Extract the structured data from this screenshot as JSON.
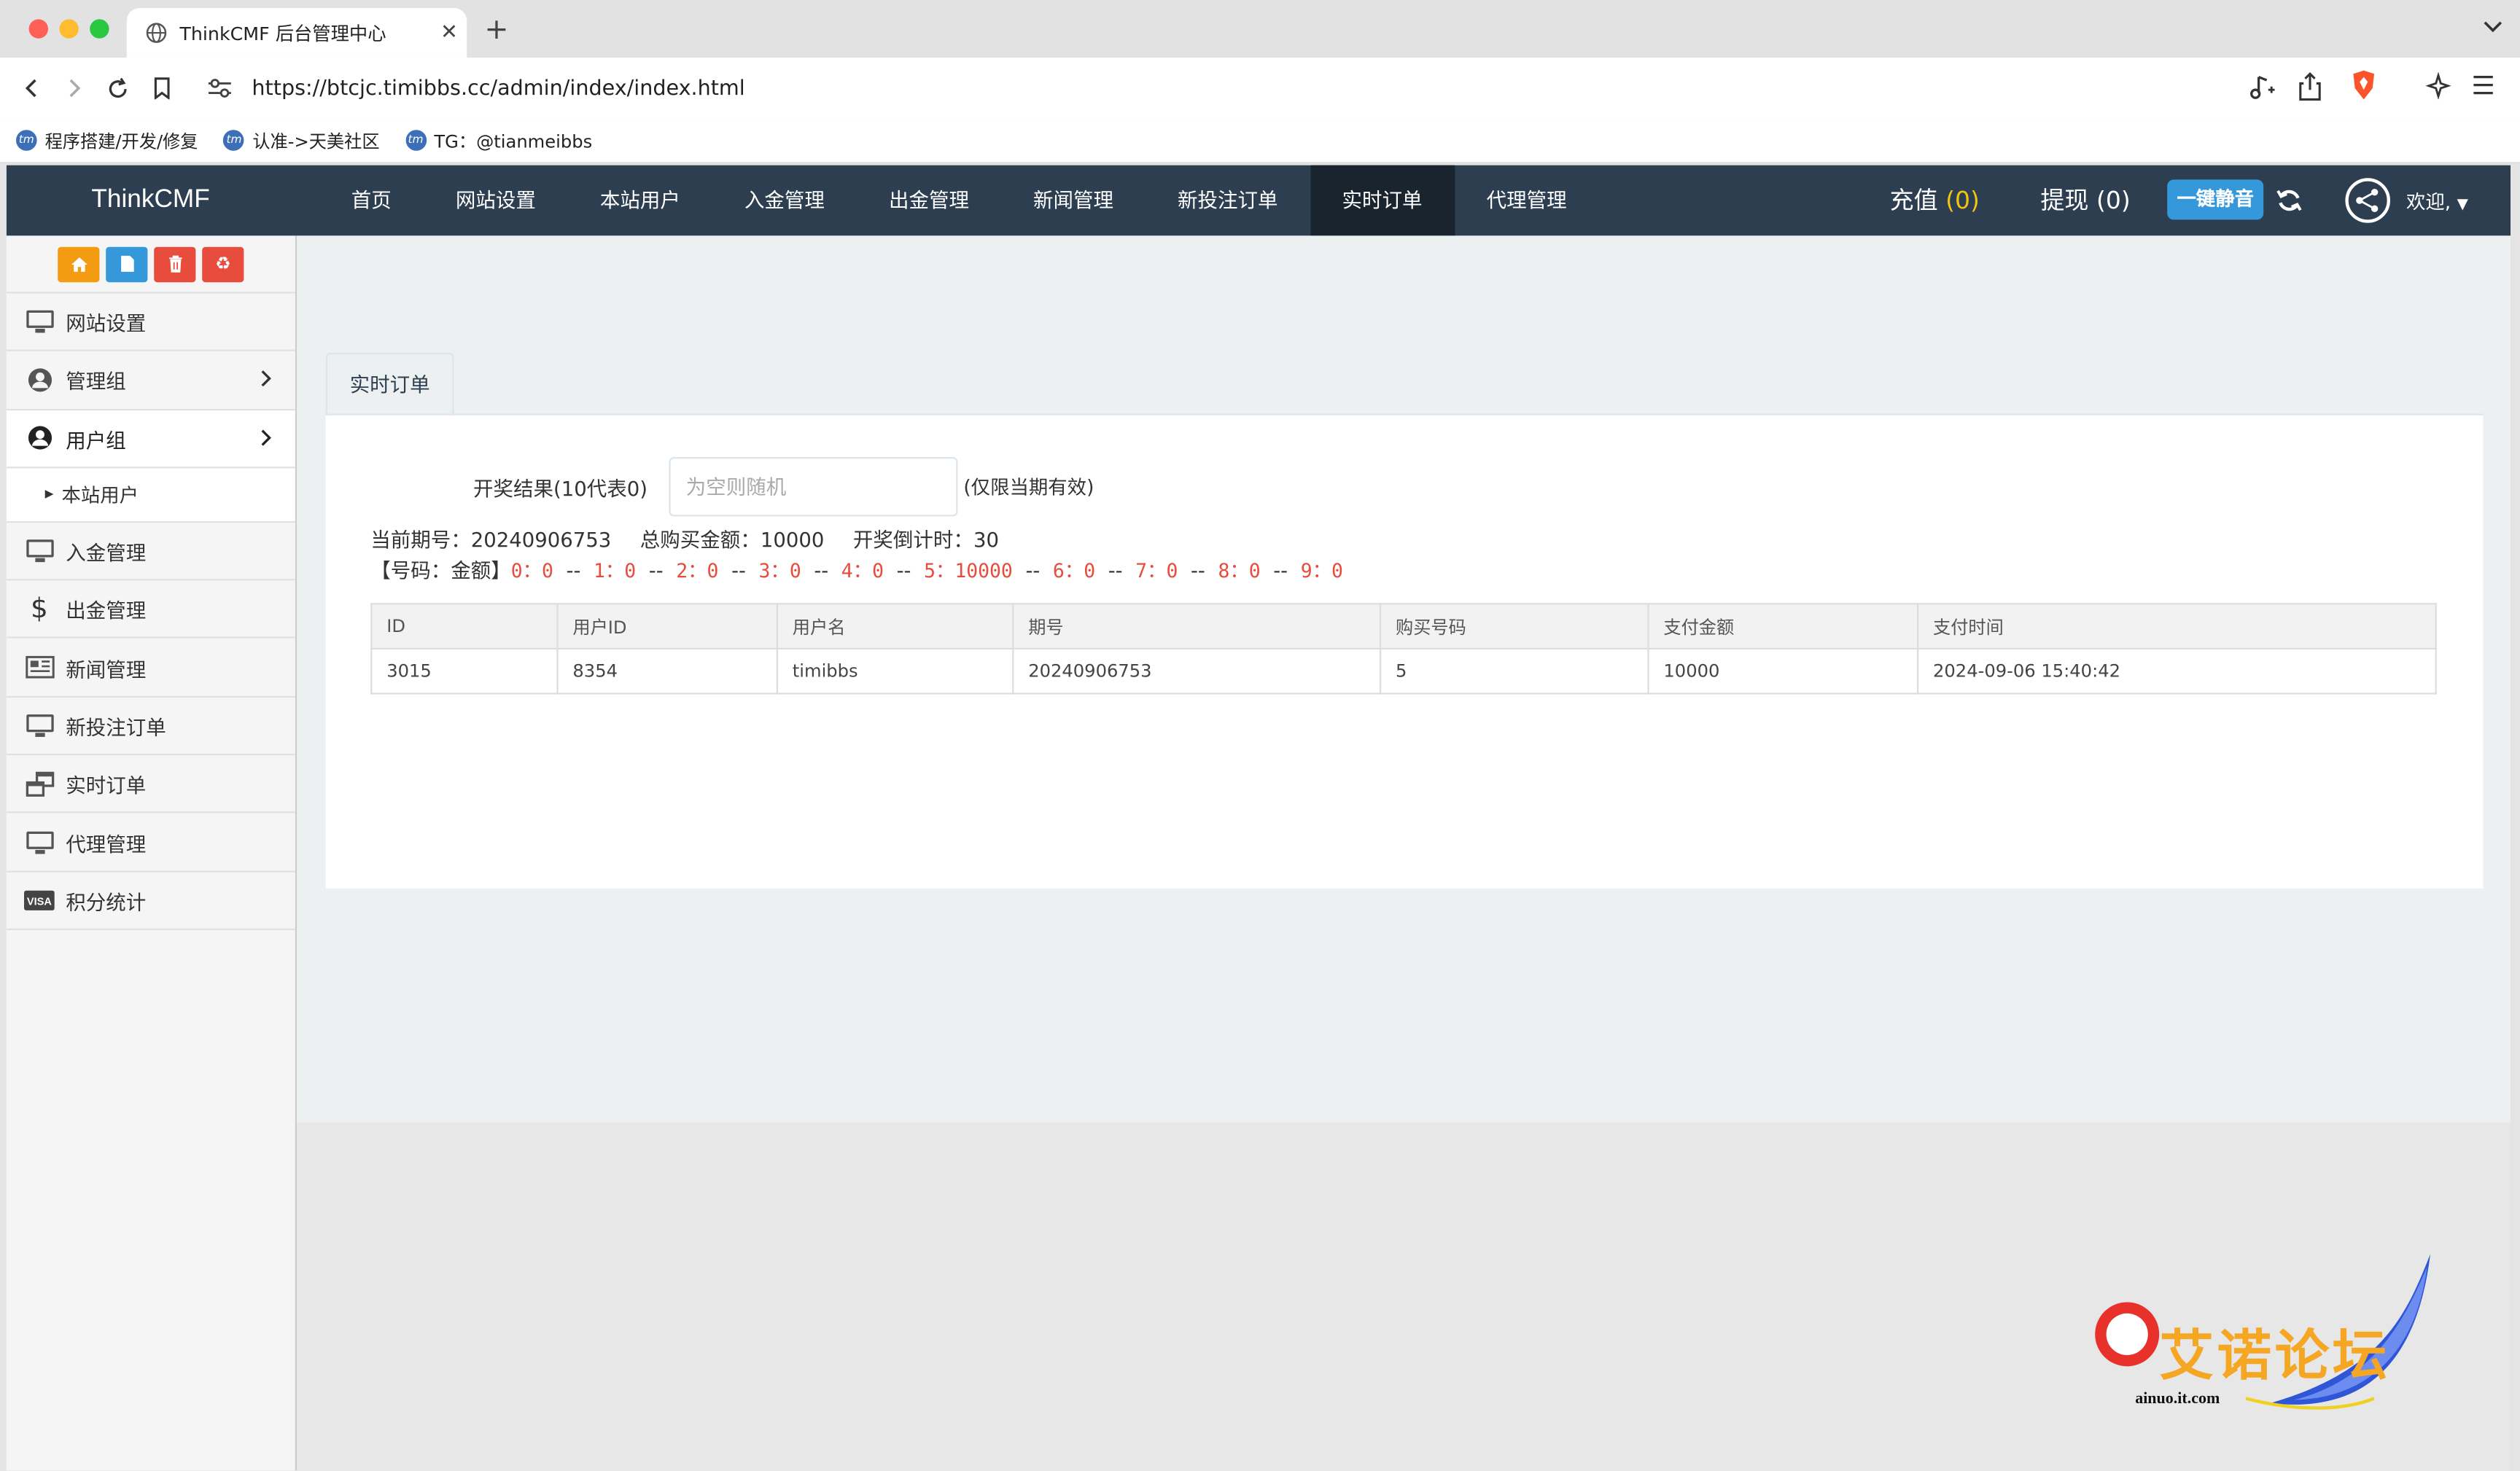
{
  "browser": {
    "tab_title": "ThinkCMF 后台管理中心",
    "url": "https://btcjc.timibbs.cc/admin/index/index.html",
    "bookmarks": [
      {
        "label": "程序搭建/开发/修复"
      },
      {
        "label": "认准->天美社区"
      },
      {
        "label": "TG：@tianmeibbs"
      }
    ]
  },
  "navbar": {
    "brand": "ThinkCMF",
    "menu": [
      "首页",
      "网站设置",
      "本站用户",
      "入金管理",
      "出金管理",
      "新闻管理",
      "新投注订单",
      "实时订单",
      "代理管理"
    ],
    "active_menu": "实时订单",
    "recharge_label": "充值",
    "recharge_count": "(0)",
    "withdraw_label": "提现",
    "withdraw_count": "(0)",
    "mute_button": "一键静音",
    "welcome": "欢迎,"
  },
  "sidebar": {
    "items": [
      {
        "label": "网站设置",
        "icon": "monitor-icon"
      },
      {
        "label": "管理组",
        "icon": "user-circle-icon"
      },
      {
        "label": "用户组",
        "icon": "user-circle-icon"
      },
      {
        "label": "入金管理",
        "icon": "monitor-icon"
      },
      {
        "label": "出金管理",
        "icon": "dollar-icon"
      },
      {
        "label": "新闻管理",
        "icon": "newspaper-icon"
      },
      {
        "label": "新投注订单",
        "icon": "monitor-icon"
      },
      {
        "label": "实时订单",
        "icon": "windows-icon"
      },
      {
        "label": "代理管理",
        "icon": "monitor-icon"
      },
      {
        "label": "积分统计",
        "icon": "visa-card-icon"
      }
    ],
    "subitem": "本站用户"
  },
  "page": {
    "tab": "实时订单",
    "form_label": "开奖结果(10代表0)",
    "form_placeholder": "为空则随机",
    "form_note": "(仅限当期有效)",
    "info": {
      "period_label": "当前期号：",
      "period": "20240906753",
      "total_label": "总购买金额：",
      "total": "10000",
      "countdown_label": "开奖倒计时：",
      "countdown": "30"
    },
    "nums_prefix": "【号码：金额】",
    "nums": [
      "0：0",
      "1：0",
      "2：0",
      "3：0",
      "4：0",
      "5：10000",
      "6：0",
      "7：0",
      "8：0",
      "9：0"
    ],
    "nums_separator": "--",
    "table": {
      "headers": [
        "ID",
        "用户ID",
        "用户名",
        "期号",
        "购买号码",
        "支付金额",
        "支付时间"
      ],
      "rows": [
        [
          "3015",
          "8354",
          "timibbs",
          "20240906753",
          "5",
          "10000",
          "2024-09-06 15:40:42"
        ]
      ]
    }
  },
  "watermark": {
    "title": "艾诺论坛",
    "site": "ainuo.it.com"
  },
  "colors": {
    "navbar": "#2c3e50",
    "navbar_active": "#1a242f",
    "accent_blue": "#3498db",
    "red_numbers": "#e74c3c",
    "count_yellow": "#f1c40f"
  }
}
